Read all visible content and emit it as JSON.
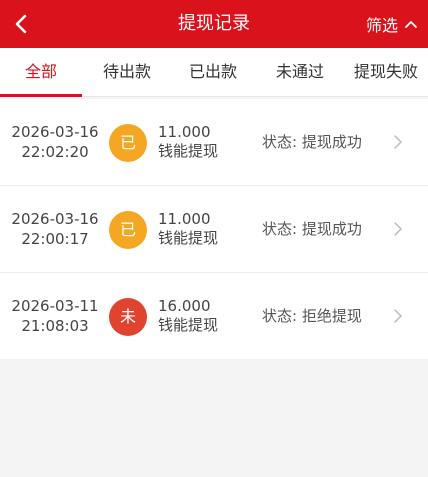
{
  "header": {
    "title": "提现记录",
    "filter_label": "筛选",
    "back_icon": "back-chevron-left-icon",
    "filter_icon": "chevron-up-icon",
    "background_color": "#d9121b"
  },
  "tabs": [
    {
      "label": "全部",
      "active": true
    },
    {
      "label": "待出款",
      "active": false
    },
    {
      "label": "已出款",
      "active": false
    },
    {
      "label": "未通过",
      "active": false
    },
    {
      "label": "提现失败",
      "active": false
    }
  ],
  "records": [
    {
      "date": "2026-03-16",
      "time": "22:02:20",
      "badge": "已",
      "badge_color": "#f5a623",
      "amount": "11.000",
      "type": "钱能提现",
      "status_prefix": "状态:",
      "status": "提现成功"
    },
    {
      "date": "2026-03-16",
      "time": "22:00:17",
      "badge": "已",
      "badge_color": "#f5a623",
      "amount": "11.000",
      "type": "钱能提现",
      "status_prefix": "状态:",
      "status": "提现成功"
    },
    {
      "date": "2026-03-11",
      "time": "21:08:03",
      "badge": "未",
      "badge_color": "#e0442f",
      "amount": "16.000",
      "type": "钱能提现",
      "status_prefix": "状态:",
      "status": "拒绝提现"
    }
  ],
  "colors": {
    "accent": "#d9121b",
    "background": "#f4f4f4"
  }
}
